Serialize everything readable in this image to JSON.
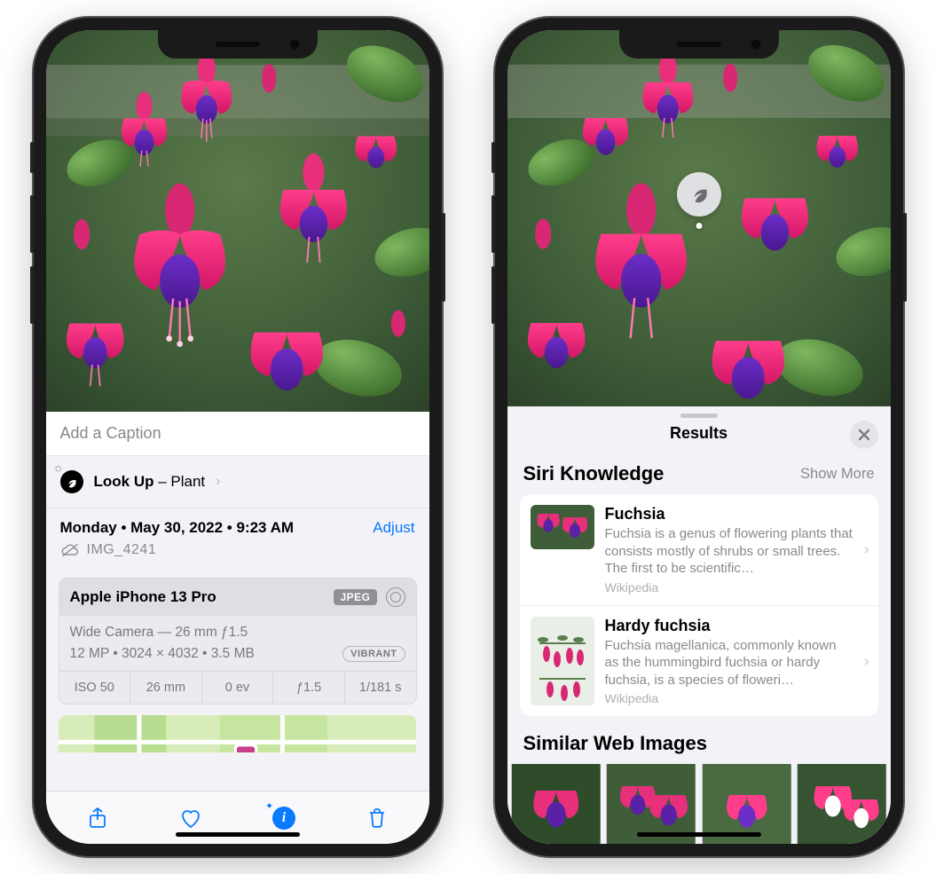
{
  "left": {
    "caption_placeholder": "Add a Caption",
    "lookup": {
      "label": "Look Up",
      "category": "Plant"
    },
    "date_line": "Monday • May 30, 2022 • 9:23 AM",
    "adjust_label": "Adjust",
    "filename": "IMG_4241",
    "camera": {
      "device": "Apple iPhone 13 Pro",
      "format": "JPEG",
      "lens_line": "Wide Camera — 26 mm ƒ1.5",
      "stats_line": "12 MP  •  3024 × 4032  •  3.5 MB",
      "style_tag": "VIBRANT",
      "exif": {
        "iso": "ISO 50",
        "focal": "26 mm",
        "ev": "0 ev",
        "aperture": "ƒ1.5",
        "shutter": "1/181 s"
      }
    },
    "toolbar": {
      "share": "share-button",
      "favorite": "favorite-button",
      "info": "info-button",
      "trash": "delete-button"
    }
  },
  "right": {
    "sheet_title": "Results",
    "siri_section": "Siri Knowledge",
    "show_more": "Show More",
    "results": [
      {
        "title": "Fuchsia",
        "desc": "Fuchsia is a genus of flowering plants that consists mostly of shrubs or small trees. The first to be scientific…",
        "source": "Wikipedia"
      },
      {
        "title": "Hardy fuchsia",
        "desc": "Fuchsia magellanica, commonly known as the hummingbird fuchsia or hardy fuchsia, is a species of floweri…",
        "source": "Wikipedia"
      }
    ],
    "web_images_section": "Similar Web Images"
  }
}
